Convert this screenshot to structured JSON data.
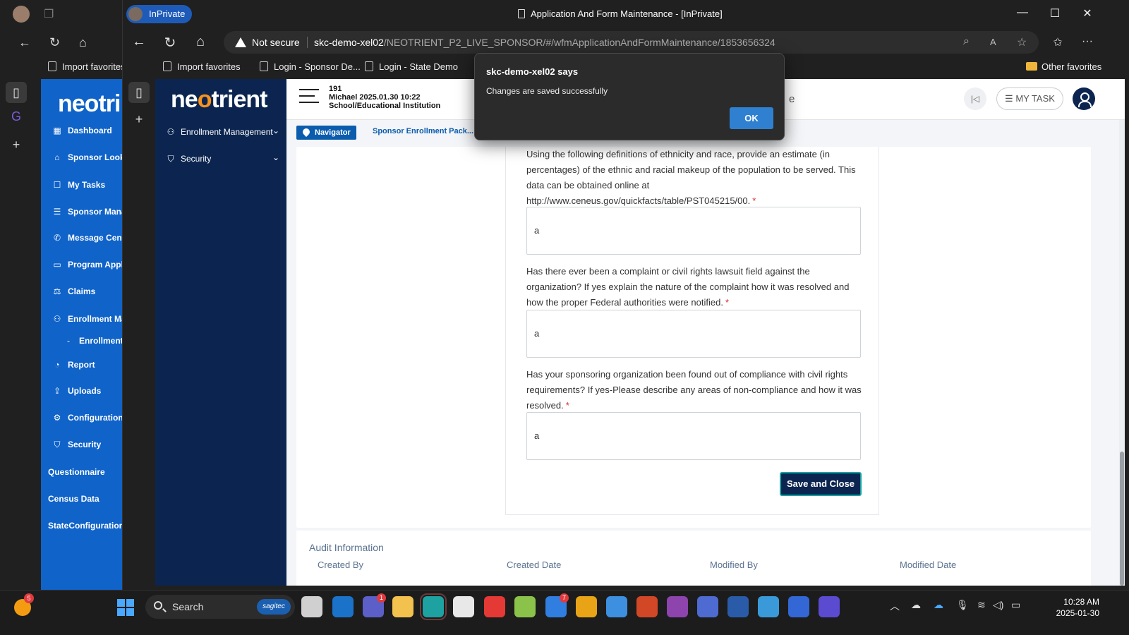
{
  "front_window": {
    "inprivate_label": "InPrivate",
    "title": "Application And Form Maintenance - [InPrivate]",
    "security_label": "Not secure",
    "url_host": "skc-demo-xel02",
    "url_path": "/NEOTRIENT_P2_LIVE_SPONSOR/#/wfmApplicationAndFormMaintenance/1853656324",
    "favorites": [
      "Import favorites",
      "Login - Sponsor De...",
      "Login - State Demo"
    ],
    "other_favorites": "Other favorites"
  },
  "back_window": {
    "favorites": [
      "Import favorites"
    ],
    "logo": "neotri",
    "sidebar": [
      {
        "icon": "dashboard-icon",
        "glyph": "▦",
        "label": "Dashboard"
      },
      {
        "icon": "bank-icon",
        "glyph": "⌂",
        "label": "Sponsor Looku"
      },
      {
        "icon": "tasks-icon",
        "glyph": "☐",
        "label": "My Tasks"
      },
      {
        "icon": "sponsor-manage-icon",
        "glyph": "☰",
        "label": "Sponsor Manag"
      },
      {
        "icon": "phone-icon",
        "glyph": "✆",
        "label": "Message Cent"
      },
      {
        "icon": "program-icon",
        "glyph": "▭",
        "label": "Program Applic"
      },
      {
        "icon": "claims-icon",
        "glyph": "⚖",
        "label": "Claims"
      },
      {
        "icon": "enrollment-icon",
        "glyph": "⚇",
        "label": "Enrollment Man"
      },
      {
        "icon": "",
        "glyph": "-",
        "label": "Enrollment Lo"
      },
      {
        "icon": "report-icon",
        "glyph": "◔",
        "label": "Report"
      },
      {
        "icon": "upload-icon",
        "glyph": "⇪",
        "label": "Uploads"
      },
      {
        "icon": "gear-icon",
        "glyph": "⚙",
        "label": "Configurations"
      },
      {
        "icon": "shield-icon",
        "glyph": "⛉",
        "label": "Security"
      }
    ],
    "plain_items": [
      "Questionnaire",
      "Census Data",
      "StateConfiguration"
    ]
  },
  "app": {
    "logo_before": "ne",
    "logo_dot": "o",
    "logo_after": "trient",
    "sidebar": [
      {
        "label": "Enrollment Management",
        "glyph": "⚇"
      },
      {
        "label": "Security",
        "glyph": "⛉"
      }
    ],
    "header": {
      "line1": "191",
      "line2": "Michael 2025.01.30 10:22",
      "line3": "School/Educational Institution",
      "partial_title": "e",
      "my_task": "☰ MY TASK"
    },
    "navigator_label": "Navigator",
    "breadcrumb": "Sponsor Enrollment Pack...",
    "questions": [
      {
        "text": "Using the following definitions of ethnicity and race, provide an estimate (in percentages) of the ethnic and racial makeup of the population to be served. This data can be obtained online at http://www.ceneus.gov/quickfacts/table/PST045215/00.",
        "required": "*",
        "answer": "a"
      },
      {
        "text": "Has there ever been a complaint or civil rights lawsuit field against the organization? If yes explain the nature of the complaint how it was resolved and how the proper Federal authorities were notified.",
        "required": "*",
        "answer": "a"
      },
      {
        "text": "Has your sponsoring organization been found out of compliance with civil rights requirements? If yes-Please describe any areas of non-compliance and how it was resolved.",
        "required": "*",
        "answer": "a"
      }
    ],
    "save_close": "Save and Close",
    "audit": {
      "title": "Audit Information",
      "columns": [
        "Created By",
        "Created Date",
        "Modified By",
        "Modified Date"
      ]
    }
  },
  "dialog": {
    "title": "skc-demo-xel02 says",
    "message": "Changes are saved successfully",
    "ok": "OK"
  },
  "taskbar": {
    "weather_badge": "5",
    "search_label": "Search",
    "search_brand": "sagitec",
    "teams_badge": "1",
    "todo_badge": "7",
    "time": "10:28 AM",
    "date": "2025-01-30"
  }
}
